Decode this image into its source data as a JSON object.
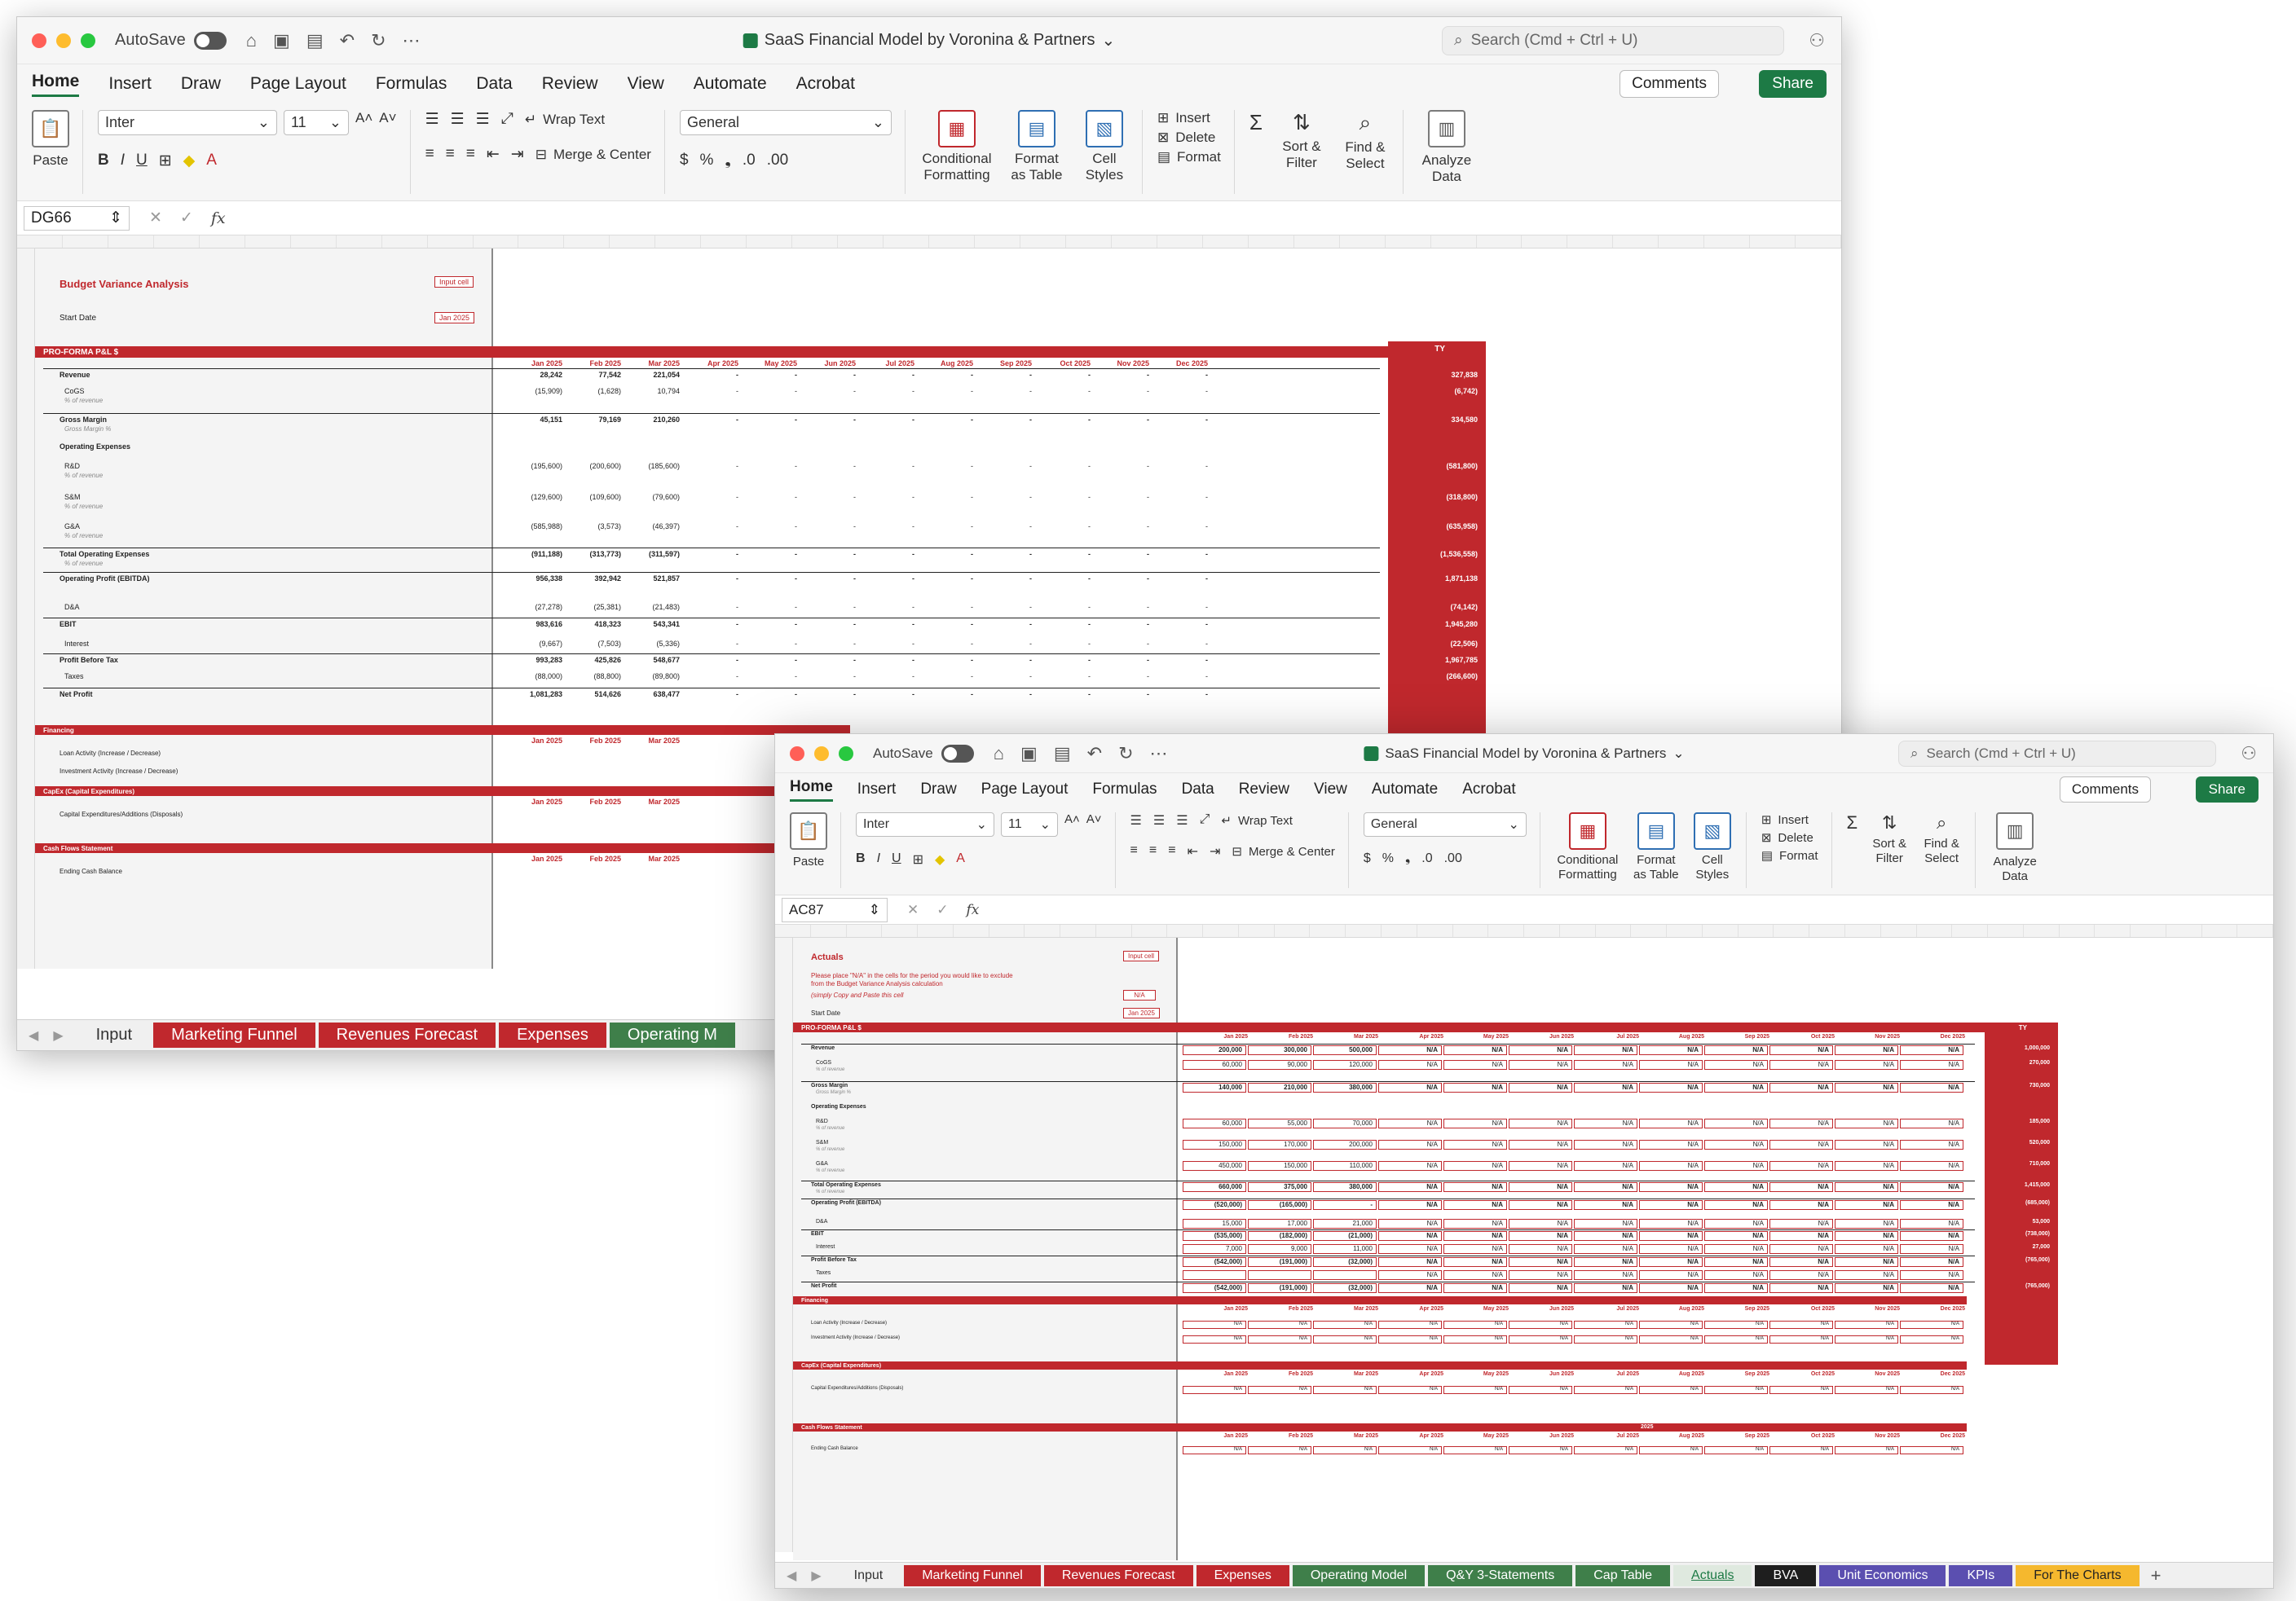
{
  "app": {
    "autosave_label": "AutoSave",
    "doc_title": "SaaS Financial Model by Voronina & Partners",
    "search_placeholder": "Search (Cmd + Ctrl + U)",
    "comments_label": "Comments",
    "share_label": "Share"
  },
  "ribbon_tabs": [
    "Home",
    "Insert",
    "Draw",
    "Page Layout",
    "Formulas",
    "Data",
    "Review",
    "View",
    "Automate",
    "Acrobat"
  ],
  "ribbon": {
    "paste": "Paste",
    "font_name": "Inter",
    "font_size": "11",
    "wrap_text": "Wrap Text",
    "merge_center": "Merge & Center",
    "number_format": "General",
    "conditional_formatting": "Conditional Formatting",
    "format_as_table": "Format as Table",
    "cell_styles": "Cell Styles",
    "insert": "Insert",
    "delete": "Delete",
    "format": "Format",
    "sort_filter": "Sort & Filter",
    "find_select": "Find & Select",
    "analyze_data": "Analyze Data"
  },
  "back_window": {
    "cell_ref": "DG66",
    "title": "Budget Variance Analysis",
    "input_tag": "Input cell",
    "start_date_label": "Start Date",
    "start_date_value": "Jan 2025",
    "section_pl": "PRO-FORMA P&L $",
    "ty_label": "TY",
    "months": [
      "Jan 2025",
      "Feb 2025",
      "Mar 2025",
      "Apr 2025",
      "May 2025",
      "Jun 2025",
      "Jul 2025",
      "Aug 2025",
      "Sep 2025",
      "Oct 2025",
      "Nov 2025",
      "Dec 2025"
    ],
    "rows": [
      {
        "label": "Revenue",
        "bold": true,
        "vals": [
          "28,242",
          "77,542",
          "221,054"
        ],
        "ty": "327,838"
      },
      {
        "label": "CoGS",
        "sub": "% of revenue",
        "vals": [
          "(15,909)",
          "(1,628)",
          "10,794"
        ],
        "ty": "(6,742)"
      },
      {
        "label": "Gross Margin",
        "bold": true,
        "sub": "Gross Margin %",
        "vals": [
          "45,151",
          "79,169",
          "210,260"
        ],
        "ty": "334,580"
      },
      {
        "label": "Operating Expenses",
        "bold": true,
        "vals": [],
        "ty": ""
      },
      {
        "label": "R&D",
        "sub": "% of revenue",
        "vals": [
          "(195,600)",
          "(200,600)",
          "(185,600)"
        ],
        "ty": "(581,800)"
      },
      {
        "label": "S&M",
        "sub": "% of revenue",
        "vals": [
          "(129,600)",
          "(109,600)",
          "(79,600)"
        ],
        "ty": "(318,800)"
      },
      {
        "label": "G&A",
        "sub": "% of revenue",
        "vals": [
          "(585,988)",
          "(3,573)",
          "(46,397)"
        ],
        "ty": "(635,958)"
      },
      {
        "label": "Total Operating Expenses",
        "bold": true,
        "sub": "% of revenue",
        "vals": [
          "(911,188)",
          "(313,773)",
          "(311,597)"
        ],
        "ty": "(1,536,558)"
      },
      {
        "label": "Operating Profit (EBITDA)",
        "bold": true,
        "vals": [
          "956,338",
          "392,942",
          "521,857"
        ],
        "ty": "1,871,138"
      },
      {
        "label": "D&A",
        "vals": [
          "(27,278)",
          "(25,381)",
          "(21,483)"
        ],
        "ty": "(74,142)"
      },
      {
        "label": "EBIT",
        "bold": true,
        "vals": [
          "983,616",
          "418,323",
          "543,341"
        ],
        "ty": "1,945,280"
      },
      {
        "label": "Interest",
        "vals": [
          "(9,667)",
          "(7,503)",
          "(5,336)"
        ],
        "ty": "(22,506)"
      },
      {
        "label": "Profit Before Tax",
        "bold": true,
        "vals": [
          "993,283",
          "425,826",
          "548,677"
        ],
        "ty": "1,967,785"
      },
      {
        "label": "Taxes",
        "vals": [
          "(88,000)",
          "(88,800)",
          "(89,800)"
        ],
        "ty": "(266,600)"
      },
      {
        "label": "Net Profit",
        "bold": true,
        "vals": [
          "1,081,283",
          "514,626",
          "638,477"
        ],
        "ty": ""
      }
    ],
    "financing": {
      "title": "Financing",
      "months": [
        "Jan 2025",
        "Feb 2025",
        "Mar 2025"
      ],
      "rows": [
        "Loan Activity (Increase / Decrease)",
        "Investment Activity (Increase / Decrease)"
      ]
    },
    "capex": {
      "title": "CapEx (Capital Expenditures)",
      "months": [
        "Jan 2025",
        "Feb 2025",
        "Mar 2025"
      ],
      "rows": [
        "Capital Expenditures/Additions (Disposals)"
      ]
    },
    "cashflow": {
      "title": "Cash Flows Statement",
      "months": [
        "Jan 2025",
        "Feb 2025",
        "Mar 2025"
      ],
      "rows": [
        "Ending Cash Balance"
      ]
    },
    "tabs": [
      "Input",
      "Marketing Funnel",
      "Revenues Forecast",
      "Expenses",
      "Operating M"
    ]
  },
  "front_window": {
    "cell_ref": "AC87",
    "title": "Actuals",
    "input_tag": "Input cell",
    "note": "Please place \"N/A\" in the cells for the period you would like to exclude from the Budget Variance Analysis calculation",
    "note2": "(simply Copy and Paste this cell",
    "na_value": "N/A",
    "start_date_label": "Start Date",
    "start_date_value": "Jan 2025",
    "section_pl": "PRO-FORMA P&L $",
    "ty_label": "TY",
    "months": [
      "Jan 2025",
      "Feb 2025",
      "Mar 2025",
      "Apr 2025",
      "May 2025",
      "Jun 2025",
      "Jul 2025",
      "Aug 2025",
      "Sep 2025",
      "Oct 2025",
      "Nov 2025",
      "Dec 2025"
    ],
    "rows": [
      {
        "label": "Revenue",
        "bold": true,
        "vals": [
          "200,000",
          "300,000",
          "500,000"
        ],
        "ty": "1,000,000"
      },
      {
        "label": "CoGS",
        "sub": "% of revenue",
        "vals": [
          "60,000",
          "90,000",
          "120,000"
        ],
        "ty": "270,000"
      },
      {
        "label": "Gross Margin",
        "bold": true,
        "sub": "Gross Margin %",
        "vals": [
          "140,000",
          "210,000",
          "380,000"
        ],
        "ty": "730,000"
      },
      {
        "label": "Operating Expenses",
        "bold": true,
        "vals": [],
        "ty": ""
      },
      {
        "label": "R&D",
        "sub": "% of revenue",
        "vals": [
          "60,000",
          "55,000",
          "70,000"
        ],
        "ty": "185,000"
      },
      {
        "label": "S&M",
        "sub": "% of revenue",
        "vals": [
          "150,000",
          "170,000",
          "200,000"
        ],
        "ty": "520,000"
      },
      {
        "label": "G&A",
        "sub": "% of revenue",
        "vals": [
          "450,000",
          "150,000",
          "110,000"
        ],
        "ty": "710,000"
      },
      {
        "label": "Total Operating Expenses",
        "bold": true,
        "sub": "% of revenue",
        "vals": [
          "660,000",
          "375,000",
          "380,000"
        ],
        "ty": "1,415,000"
      },
      {
        "label": "Operating Profit (EBITDA)",
        "bold": true,
        "vals": [
          "(520,000)",
          "(165,000)",
          "-"
        ],
        "ty": "(685,000)"
      },
      {
        "label": "D&A",
        "vals": [
          "15,000",
          "17,000",
          "21,000"
        ],
        "ty": "53,000"
      },
      {
        "label": "EBIT",
        "bold": true,
        "vals": [
          "(535,000)",
          "(182,000)",
          "(21,000)"
        ],
        "ty": "(738,000)"
      },
      {
        "label": "Interest",
        "vals": [
          "7,000",
          "9,000",
          "11,000"
        ],
        "ty": "27,000"
      },
      {
        "label": "Profit Before Tax",
        "bold": true,
        "vals": [
          "(542,000)",
          "(191,000)",
          "(32,000)"
        ],
        "ty": "(765,000)"
      },
      {
        "label": "Taxes",
        "vals": [
          "",
          "",
          ""
        ],
        "ty": ""
      },
      {
        "label": "Net Profit",
        "bold": true,
        "vals": [
          "(542,000)",
          "(191,000)",
          "(32,000)"
        ],
        "ty": "(765,000)"
      }
    ],
    "financing": {
      "title": "Financing",
      "rows": [
        "Loan Activity (Increase / Decrease)",
        "Investment Activity (Increase / Decrease)"
      ]
    },
    "capex": {
      "title": "CapEx (Capital Expenditures)",
      "rows": [
        "Capital Expenditures/Additions (Disposals)"
      ]
    },
    "cashflow": {
      "title": "Cash Flows Statement",
      "year": "2025",
      "rows": [
        "Ending Cash Balance"
      ]
    },
    "tabs": [
      {
        "label": "Input",
        "style": "plain"
      },
      {
        "label": "Marketing Funnel",
        "style": "red"
      },
      {
        "label": "Revenues Forecast",
        "style": "red"
      },
      {
        "label": "Expenses",
        "style": "red"
      },
      {
        "label": "Operating Model",
        "style": "green"
      },
      {
        "label": "Q&Y 3-Statements",
        "style": "green"
      },
      {
        "label": "Cap Table",
        "style": "green"
      },
      {
        "label": "Actuals",
        "style": "active"
      },
      {
        "label": "BVA",
        "style": "black"
      },
      {
        "label": "Unit Economics",
        "style": "purple"
      },
      {
        "label": "KPIs",
        "style": "purple"
      },
      {
        "label": "For The Charts",
        "style": "yellow"
      }
    ]
  },
  "colors": {
    "brand_red": "#c0282d",
    "excel_green": "#1d7a45"
  }
}
